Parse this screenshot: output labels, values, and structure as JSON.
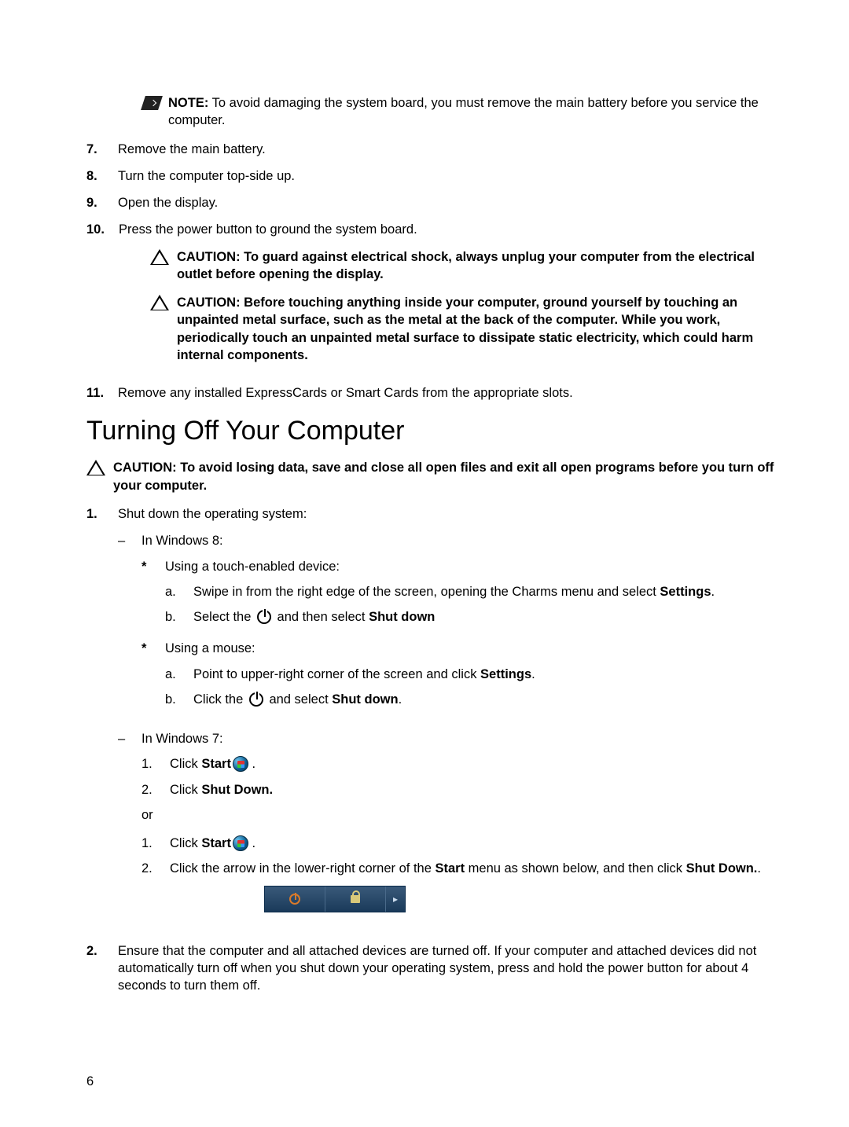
{
  "note1": {
    "label": "NOTE:",
    "text": " To avoid damaging the system board, you must remove the main battery before you service the computer."
  },
  "steps_top": {
    "s7": {
      "n": "7.",
      "t": "Remove the main battery."
    },
    "s8": {
      "n": "8.",
      "t": "Turn the computer top-side up."
    },
    "s9": {
      "n": "9.",
      "t": "Open the display."
    },
    "s10": {
      "n": "10.",
      "t": "Press the power button to ground the system board."
    }
  },
  "caution1": "CAUTION: To guard against electrical shock, always unplug your computer from the electrical outlet before opening the display.",
  "caution2": "CAUTION: Before touching anything inside your computer, ground yourself by touching an unpainted metal surface, such as the metal at the back of the computer. While you work, periodically touch an unpainted metal surface to dissipate static electricity, which could harm internal components.",
  "s11": {
    "n": "11.",
    "t": "Remove any installed ExpressCards or Smart Cards from the appropriate slots."
  },
  "heading": "Turning Off Your Computer",
  "caution3": "CAUTION: To avoid losing data, save and close all open files and exit all open programs before you turn off your computer.",
  "step1": {
    "n": "1.",
    "t": "Shut down the operating system:"
  },
  "win8": "In Windows 8:",
  "touch_label": "Using a touch-enabled device:",
  "touch_a": "Swipe in from the right edge of the screen, opening the Charms menu and select ",
  "touch_a_bold": "Settings",
  "touch_b_pre": "Select the ",
  "touch_b_post": " and then select ",
  "touch_b_bold": "Shut down",
  "mouse_label": "Using a mouse:",
  "mouse_a_pre": "Point to upper-right corner of the screen and click ",
  "mouse_a_bold": "Settings",
  "mouse_b_pre": "Click the ",
  "mouse_b_post": " and select ",
  "mouse_b_bold": "Shut down",
  "win7": "In Windows 7:",
  "w7_1_pre": "Click ",
  "w7_1_bold": "Start",
  "w7_2_pre": "Click ",
  "w7_2_bold": "Shut Down.",
  "or": "or",
  "w7b_1_pre": "Click ",
  "w7b_1_bold": "Start",
  "w7b_2_pre": "Click the arrow in the lower-right corner of the ",
  "w7b_2_bold1": "Start",
  "w7b_2_mid": " menu as shown below, and then click ",
  "w7b_2_bold2": "Shut Down.",
  "step2": {
    "n": "2.",
    "t": "Ensure that the computer and all attached devices are turned off. If your computer and attached devices did not automatically turn off when you shut down your operating system, press and hold the power button for about 4 seconds to turn them off."
  },
  "page_num": "6"
}
